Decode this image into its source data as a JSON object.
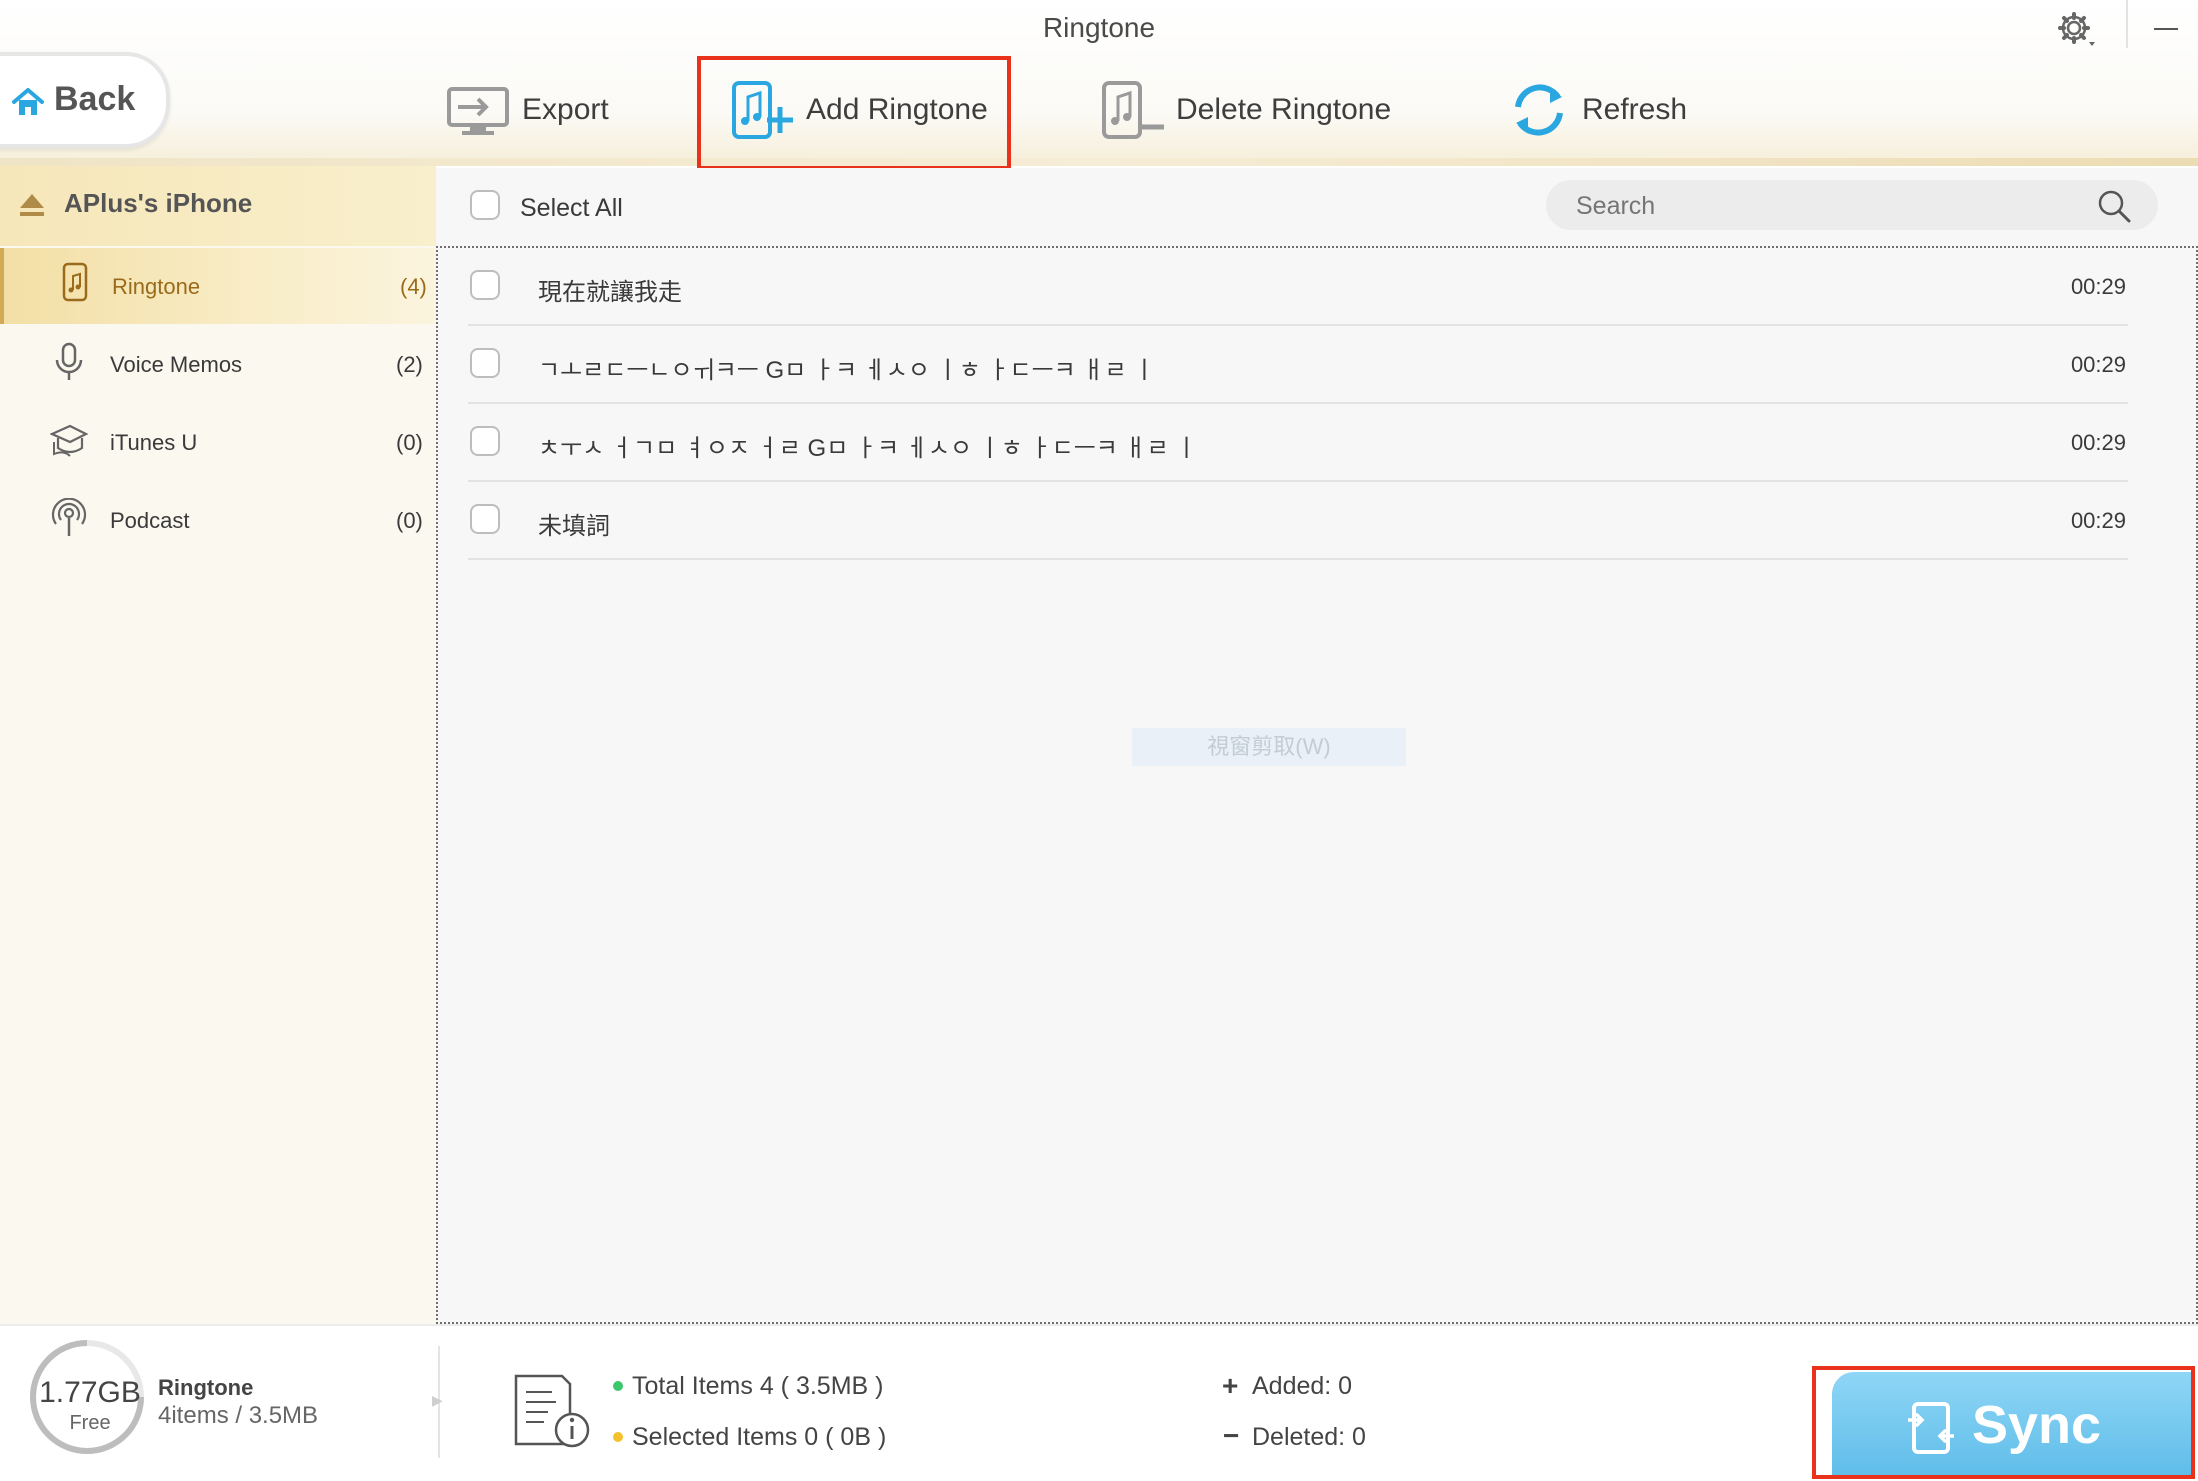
{
  "window": {
    "title": "Ringtone"
  },
  "toolbar": {
    "back_label": "Back",
    "export_label": "Export",
    "add_label": "Add Ringtone",
    "delete_label": "Delete Ringtone",
    "refresh_label": "Refresh"
  },
  "sidebar": {
    "device_name": "APlus's iPhone",
    "items": [
      {
        "label": "Ringtone",
        "count": "(4)",
        "icon": "phone-music-icon"
      },
      {
        "label": "Voice Memos",
        "count": "(2)",
        "icon": "microphone-icon"
      },
      {
        "label": "iTunes U",
        "count": "(0)",
        "icon": "graduation-cap-icon"
      },
      {
        "label": "Podcast",
        "count": "(0)",
        "icon": "podcast-icon"
      }
    ]
  },
  "list": {
    "select_all_label": "Select All",
    "search_placeholder": "Search",
    "rows": [
      {
        "title": "現在就讓我走",
        "duration": "00:29"
      },
      {
        "title": "ㄱㅗㄹㄷㅡㄴㅇㅟㅋㅡ Gㅁ ㅏㅋ ㅔㅅㅇ ㅣㅎ ㅏㄷㅡㅋ ㅐㄹ ㅣ",
        "duration": "00:29"
      },
      {
        "title": "ㅊㅜㅅ ㅓㄱㅁ ㅕㅇㅈ ㅓㄹ Gㅁ ㅏㅋ ㅔㅅㅇ ㅣㅎ ㅏㄷㅡㅋ ㅐㄹ ㅣ",
        "duration": "00:29"
      },
      {
        "title": "未填詞",
        "duration": "00:29"
      }
    ],
    "overlay_text": "視窗剪取(W)"
  },
  "footer": {
    "storage_free_value": "1.77GB",
    "storage_free_label": "Free",
    "category_title": "Ringtone",
    "category_summary": "4items / 3.5MB",
    "total_items": "Total Items 4 ( 3.5MB )",
    "selected_items": "Selected Items 0 ( 0B )",
    "added": "Added: 0",
    "deleted": "Deleted: 0",
    "sync_label": "Sync"
  },
  "colors": {
    "accent_blue": "#2aa7e0",
    "highlight_red": "#e8321c",
    "active_gold": "#d2aa56",
    "total_dot": "#3cc76c",
    "selected_dot": "#f3c12a"
  }
}
